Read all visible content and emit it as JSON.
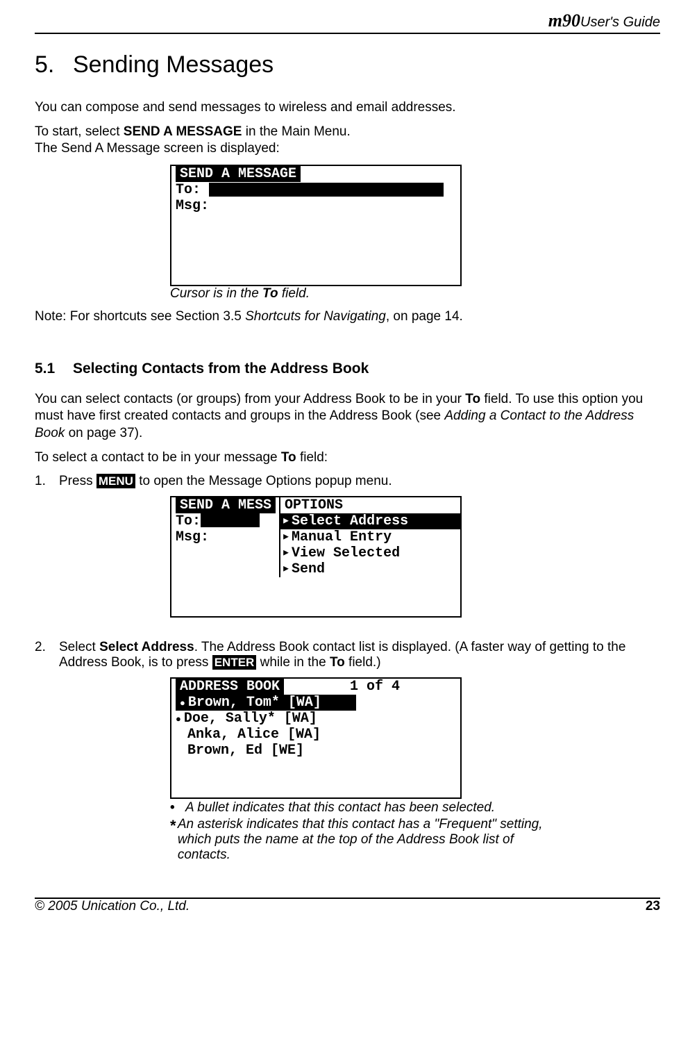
{
  "header": {
    "logo": "m90",
    "guide": "User's Guide"
  },
  "section": {
    "number": "5.",
    "title": "Sending Messages"
  },
  "intro": {
    "p1": "You can compose and send messages to wireless and email addresses.",
    "p2a": "To start, select ",
    "p2b": "SEND A MESSAGE",
    "p2c": " in the Main Menu.",
    "p3": "The Send A Message screen is displayed:"
  },
  "screen1": {
    "title": " SEND A MESSAGE ",
    "to_label": "To:",
    "msg_label": "Msg:",
    "caption_a": "Cursor is in the ",
    "caption_b": "To",
    "caption_c": " field."
  },
  "note": {
    "a": "Note: For shortcuts see Section 3.5 ",
    "b": "Shortcuts for Navigating",
    "c": ", on page 14."
  },
  "subsection": {
    "number": "5.1",
    "title": "Selecting Contacts from the Address Book"
  },
  "sub_p1": {
    "a": "You can select contacts (or groups) from your Address Book to be in your ",
    "b": "To",
    "c": " field. To use this option you must have first created contacts and groups in the Address Book (see ",
    "d": "Adding a Contact to the Address Book",
    "e": " on page 37)."
  },
  "sub_p2": {
    "a": "To select a contact to be in your message ",
    "b": "To",
    "c": " field:"
  },
  "step1": {
    "num": "1.",
    "a": "Press ",
    "key": "MENU",
    "b": " to open the Message Options popup menu."
  },
  "screen2": {
    "left_title": " SEND A MESS",
    "to_label": "To:",
    "msg_label": "Msg:",
    "opt_title": " OPTIONS",
    "items": [
      "Select Address",
      "Manual Entry",
      "View Selected",
      "Send"
    ]
  },
  "step2": {
    "num": "2.",
    "a": "Select ",
    "b": "Select Address",
    "c": ". The Address Book contact list is displayed. (A faster way of getting to the Address Book, is to press ",
    "key": "ENTER",
    "d": " while in the ",
    "e": "To",
    "f": " field.)"
  },
  "screen3": {
    "title": " ADDRESS BOOK ",
    "count": "1 of 4",
    "rows": [
      {
        "selected": true,
        "bullet": true,
        "text": "Brown, Tom* [WA]"
      },
      {
        "selected": false,
        "bullet": true,
        "text": "Doe, Sally* [WA]"
      },
      {
        "selected": false,
        "bullet": false,
        "text": "Anka, Alice [WA]"
      },
      {
        "selected": false,
        "bullet": false,
        "text": "Brown, Ed [WE]"
      }
    ]
  },
  "legend": {
    "bullet_sym": "•",
    "bullet_txt": "A bullet indicates that this contact has been selected.",
    "star_sym": "*",
    "star_txt": "An asterisk indicates that this contact has a \"Frequent\" setting, which puts the name at the top of the Address Book list of contacts."
  },
  "footer": {
    "copyright": "© 2005 Unication Co., Ltd.",
    "page": "23"
  }
}
